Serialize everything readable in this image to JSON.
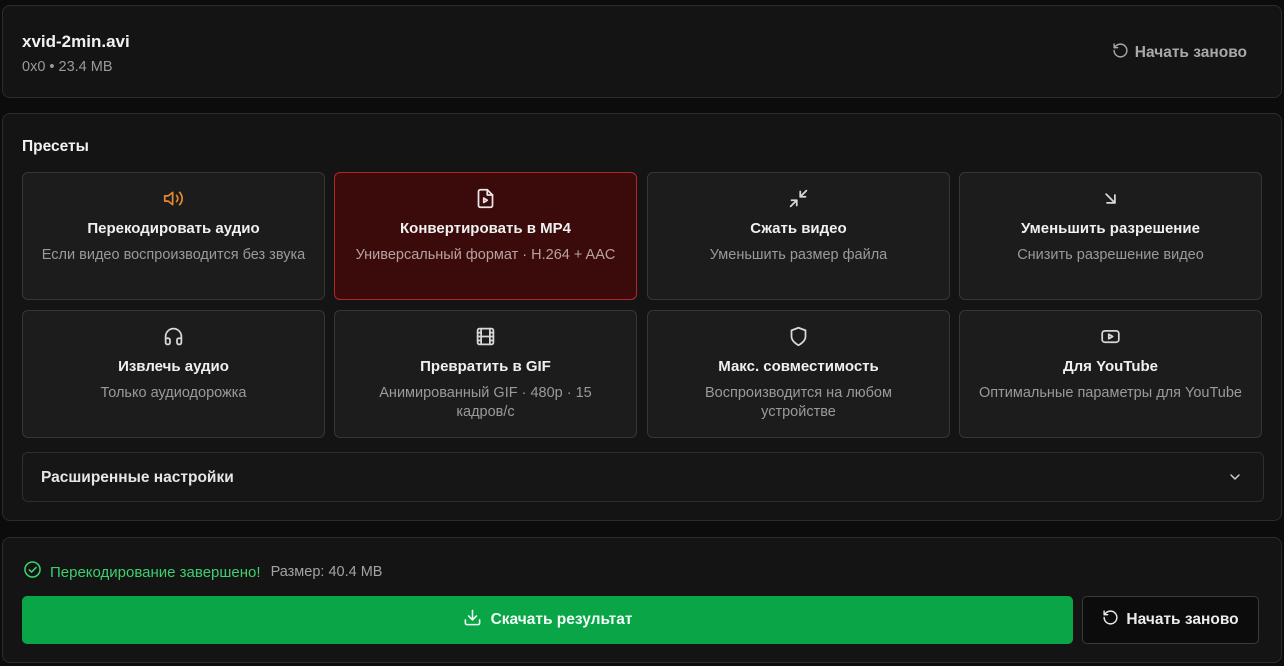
{
  "file": {
    "name": "xvid-2min.avi",
    "meta": "0x0 • 23.4 MB",
    "restart_label": "Начать заново"
  },
  "presets": {
    "title": "Пресеты",
    "items": [
      {
        "icon": "speaker-icon",
        "title": "Перекодировать аудио",
        "desc": "Если видео воспроизводится без звука",
        "selected": false,
        "icon_color": "#e0892e"
      },
      {
        "icon": "video-file-icon",
        "title": "Конвертировать в MP4",
        "desc": "Универсальный формат · H.264 + AAC",
        "selected": true,
        "icon_color": "#e6e6e6"
      },
      {
        "icon": "compress-arrows-icon",
        "title": "Сжать видео",
        "desc": "Уменьшить размер файла",
        "selected": false,
        "icon_color": "#d8d8d8"
      },
      {
        "icon": "arrow-down-right-icon",
        "title": "Уменьшить разрешение",
        "desc": "Снизить разрешение видео",
        "selected": false,
        "icon_color": "#d8d8d8"
      },
      {
        "icon": "headphones-icon",
        "title": "Извлечь аудио",
        "desc": "Только аудиодорожка",
        "selected": false,
        "icon_color": "#d8d8d8"
      },
      {
        "icon": "film-icon",
        "title": "Превратить в GIF",
        "desc": "Анимированный GIF · 480p · 15 кадров/с",
        "selected": false,
        "icon_color": "#d8d8d8"
      },
      {
        "icon": "shield-icon",
        "title": "Макс. совместимость",
        "desc": "Воспроизводится на любом устройстве",
        "selected": false,
        "icon_color": "#d8d8d8"
      },
      {
        "icon": "youtube-icon",
        "title": "Для YouTube",
        "desc": "Оптимальные параметры для YouTube",
        "selected": false,
        "icon_color": "#d8d8d8"
      }
    ],
    "advanced_label": "Расширенные настройки"
  },
  "result": {
    "status": "Перекодирование завершено!",
    "size": "Размер: 40.4 MB",
    "download_label": "Скачать результат",
    "restart_label": "Начать заново"
  },
  "colors": {
    "success": "#3ccf6e",
    "download_bg": "#0aa547",
    "selected_bg": "#3b0b0b",
    "selected_border": "#b3262a",
    "accent_orange": "#e0892e"
  }
}
